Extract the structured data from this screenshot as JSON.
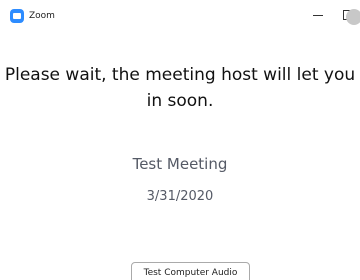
{
  "window": {
    "title": "Zoom",
    "app_icon": "zoom-logo-icon",
    "controls": [
      "minimize-icon",
      "maximize-icon",
      "close-icon"
    ]
  },
  "main": {
    "message": "Please wait, the meeting host will let you in soon.",
    "meeting_title": "Test Meeting",
    "meeting_date": "3/31/2020",
    "audio_button_label": "Test Computer Audio"
  },
  "colors": {
    "accent": "#2d8cff",
    "muted_text": "#555a66"
  }
}
